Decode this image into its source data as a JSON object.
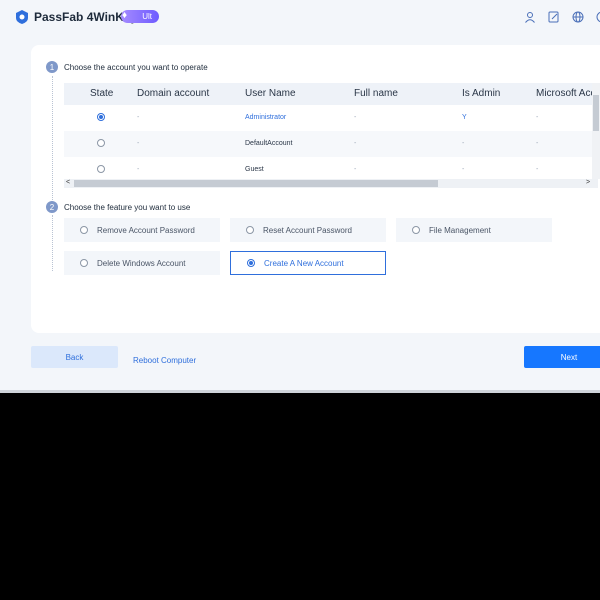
{
  "app": {
    "title": "PassFab 4WinKey",
    "badge": "Ult"
  },
  "titlebar_icons": [
    "user-icon",
    "edit-icon",
    "globe-icon",
    "info-icon"
  ],
  "step1": {
    "number": "1",
    "label": "Choose the account you want to operate"
  },
  "step2": {
    "number": "2",
    "label": "Choose the feature you want to use"
  },
  "table": {
    "headers": [
      "State",
      "Domain account",
      "User Name",
      "Full name",
      "Is Admin",
      "Microsoft Acc"
    ],
    "rows": [
      {
        "selected": true,
        "domain": "-",
        "user": "Administrator",
        "full": "-",
        "admin": "Y",
        "ms": "-"
      },
      {
        "selected": false,
        "domain": "-",
        "user": "DefaultAccount",
        "full": "-",
        "admin": "-",
        "ms": "-"
      },
      {
        "selected": false,
        "domain": "-",
        "user": "Guest",
        "full": "-",
        "admin": "-",
        "ms": "-"
      }
    ]
  },
  "features": [
    {
      "label": "Remove Account Password",
      "selected": false
    },
    {
      "label": "Reset Account Password",
      "selected": false
    },
    {
      "label": "File Management",
      "selected": false
    },
    {
      "label": "Delete Windows Account",
      "selected": false
    },
    {
      "label": "Create A New Account",
      "selected": true
    }
  ],
  "footer": {
    "back": "Back",
    "reboot": "Reboot Computer",
    "next": "Next"
  },
  "colors": {
    "accent": "#1677ff",
    "link": "#2f6fdc",
    "background": "#f3f6fa"
  }
}
